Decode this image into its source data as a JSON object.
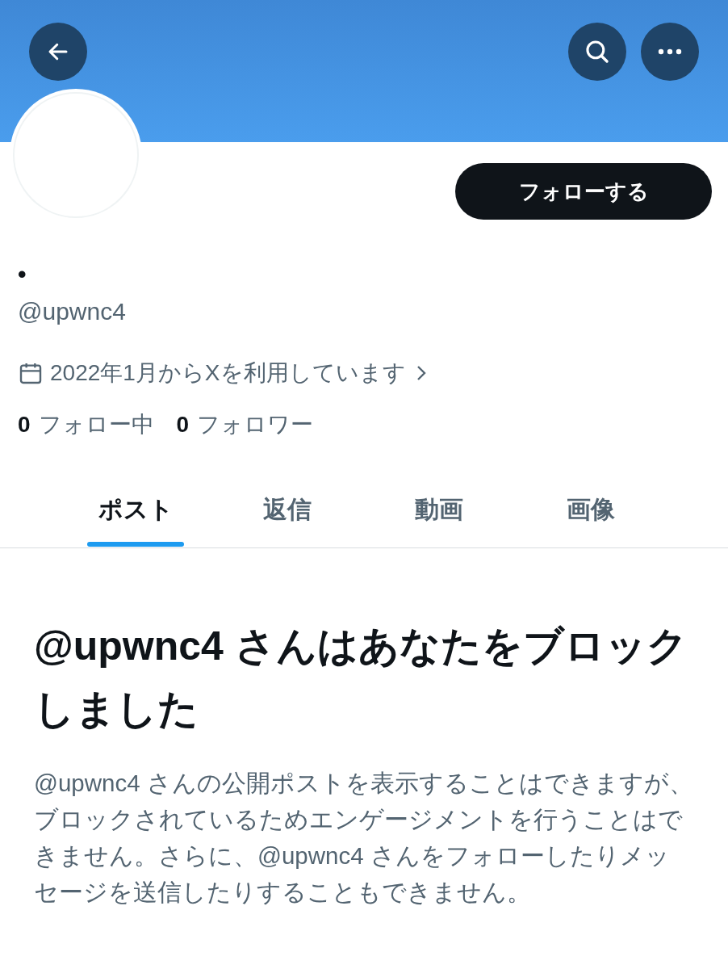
{
  "header": {
    "buttons": [
      {
        "kind": "back"
      },
      {
        "kind": "search"
      },
      {
        "kind": "more"
      }
    ]
  },
  "profile": {
    "follow_button": "フォローする",
    "display_name": "•",
    "handle": "@upwnc4",
    "joined": "2022年1月からXを利用しています",
    "stats": [
      {
        "count": "0",
        "label": "フォロー中"
      },
      {
        "count": "0",
        "label": "フォロワー"
      }
    ]
  },
  "tabs": [
    {
      "label": "ポスト",
      "selected": true
    },
    {
      "label": "返信",
      "selected": false
    },
    {
      "label": "動画",
      "selected": false
    },
    {
      "label": "画像",
      "selected": false
    }
  ],
  "blocked": {
    "title": "@upwnc4 さんはあなたをブロックしました",
    "body": "@upwnc4 さんの公開ポストを表示することはできますが、ブロックされているためエンゲージメントを行うことはできません。さらに、@upwnc4 さんをフォローしたりメッセージを送信したりすることもできません。"
  }
}
